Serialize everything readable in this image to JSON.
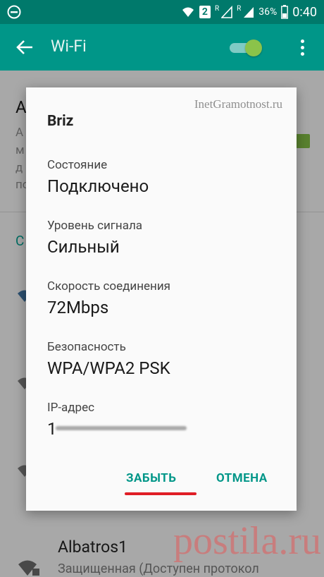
{
  "status_bar": {
    "battery_percent": "36%",
    "time": "0:40",
    "sim_slot": "2",
    "roaming_label_1": "R",
    "roaming_label_2": "R"
  },
  "app_bar": {
    "title": "Wi-Fi",
    "wifi_enabled": true
  },
  "background": {
    "heading_partial": "A",
    "sub_lines_partial": [
      "A",
      "м",
      "д",
      "по"
    ],
    "section_partial": "С",
    "network_name": "Albatros1",
    "network_status": "Защищенная (Доступен протокол"
  },
  "dialog": {
    "watermark": "InetGramotnost.ru",
    "network_name": "Briz",
    "fields": [
      {
        "label": "Состояние",
        "value": "Подключено"
      },
      {
        "label": "Уровень сигнала",
        "value": "Сильный"
      },
      {
        "label": "Скорость соединения",
        "value": "72Mbps"
      },
      {
        "label": "Безопасность",
        "value": "WPA/WPA2 PSK"
      }
    ],
    "ip_label": "IP-адрес",
    "ip_value_visible": "1",
    "forget_button": "ЗАБЫТЬ",
    "cancel_button": "ОТМЕНА"
  },
  "colors": {
    "status_bar": "#00796b",
    "app_bar": "#009688",
    "accent": "#009688",
    "highlight_underline": "#e01e26"
  },
  "watermark_bottom": "postila.ru"
}
